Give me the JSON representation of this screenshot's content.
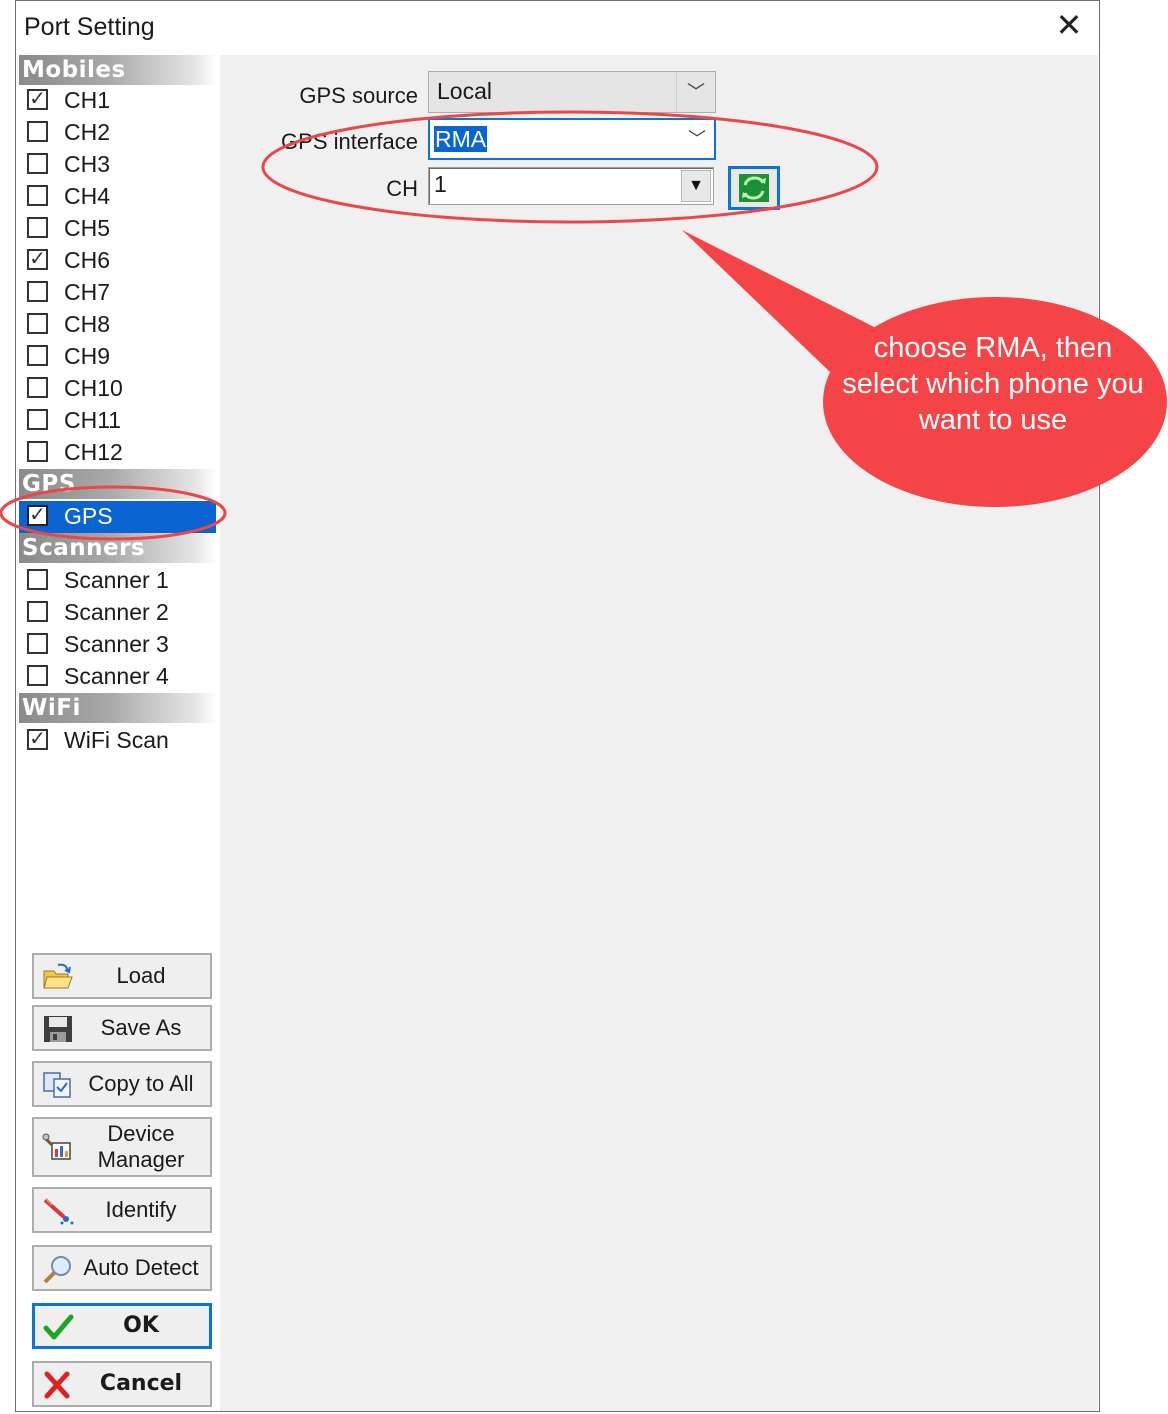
{
  "window": {
    "title": "Port Setting",
    "close_glyph": "✕"
  },
  "sidebar": {
    "groups": {
      "mobiles": "Mobiles",
      "gps": "GPS",
      "scanners": "Scanners",
      "wifi": "WiFi"
    },
    "mobiles": [
      {
        "label": "CH1",
        "checked": true
      },
      {
        "label": "CH2",
        "checked": false
      },
      {
        "label": "CH3",
        "checked": false
      },
      {
        "label": "CH4",
        "checked": false
      },
      {
        "label": "CH5",
        "checked": false
      },
      {
        "label": "CH6",
        "checked": true
      },
      {
        "label": "CH7",
        "checked": false
      },
      {
        "label": "CH8",
        "checked": false
      },
      {
        "label": "CH9",
        "checked": false
      },
      {
        "label": "CH10",
        "checked": false
      },
      {
        "label": "CH11",
        "checked": false
      },
      {
        "label": "CH12",
        "checked": false
      }
    ],
    "gps": [
      {
        "label": "GPS",
        "checked": true,
        "selected": true
      }
    ],
    "scanners": [
      {
        "label": "Scanner 1",
        "checked": false
      },
      {
        "label": "Scanner 2",
        "checked": false
      },
      {
        "label": "Scanner 3",
        "checked": false
      },
      {
        "label": "Scanner 4",
        "checked": false
      }
    ],
    "wifi": [
      {
        "label": "WiFi Scan",
        "checked": true
      }
    ]
  },
  "form": {
    "gps_source": {
      "label": "GPS source",
      "value": "Local"
    },
    "gps_interface": {
      "label": "GPS interface",
      "value": "RMA"
    },
    "ch": {
      "label": "CH",
      "value": "1"
    }
  },
  "buttons": {
    "load": "Load",
    "save_as": "Save As",
    "copy_to_all": "Copy to All",
    "device_manager": "Device Manager",
    "identify": "Identify",
    "auto_detect": "Auto Detect",
    "ok": "OK",
    "cancel": "Cancel"
  },
  "annotation": {
    "callout_text": "choose RMA, then select which phone you want to use",
    "callout_color": "#f54448",
    "ellipse_color": "#e8474b"
  },
  "colors": {
    "selection": "#0a64d2",
    "focus_border": "#0a74d8",
    "panel": "#f0f0f0"
  }
}
